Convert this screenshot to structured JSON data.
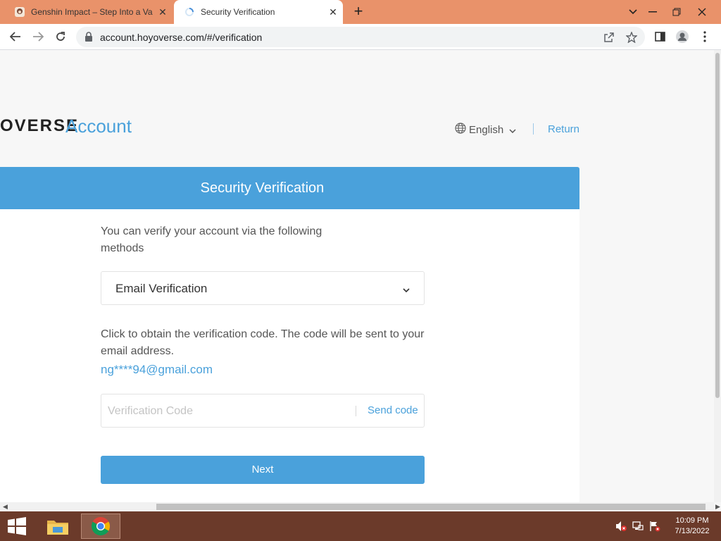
{
  "browser": {
    "tabs": [
      {
        "title": "Genshin Impact – Step Into a Vast",
        "close_icon": "close-icon"
      },
      {
        "title": "Security Verification",
        "close_icon": "close-icon"
      }
    ],
    "new_tab": "+",
    "url": "account.hoyoverse.com/#/verification"
  },
  "header": {
    "logo_text": "OVERSE",
    "logo_account": "Account",
    "language": "English",
    "return_label": "Return"
  },
  "verification": {
    "title": "Security Verification",
    "intro": "You can verify your account via the following methods",
    "method_selected": "Email Verification",
    "instructions": "Click to obtain the verification code. The code will be sent to your email address.",
    "email": "ng****94@gmail.com",
    "code_placeholder": "Verification Code",
    "send_code_label": "Send code",
    "next_label": "Next"
  },
  "taskbar": {
    "time": "10:09 PM",
    "date": "7/13/2022"
  },
  "colors": {
    "accent": "#4aa1db",
    "tabbar": "#e9926a",
    "taskbar": "#6b3a2a"
  }
}
